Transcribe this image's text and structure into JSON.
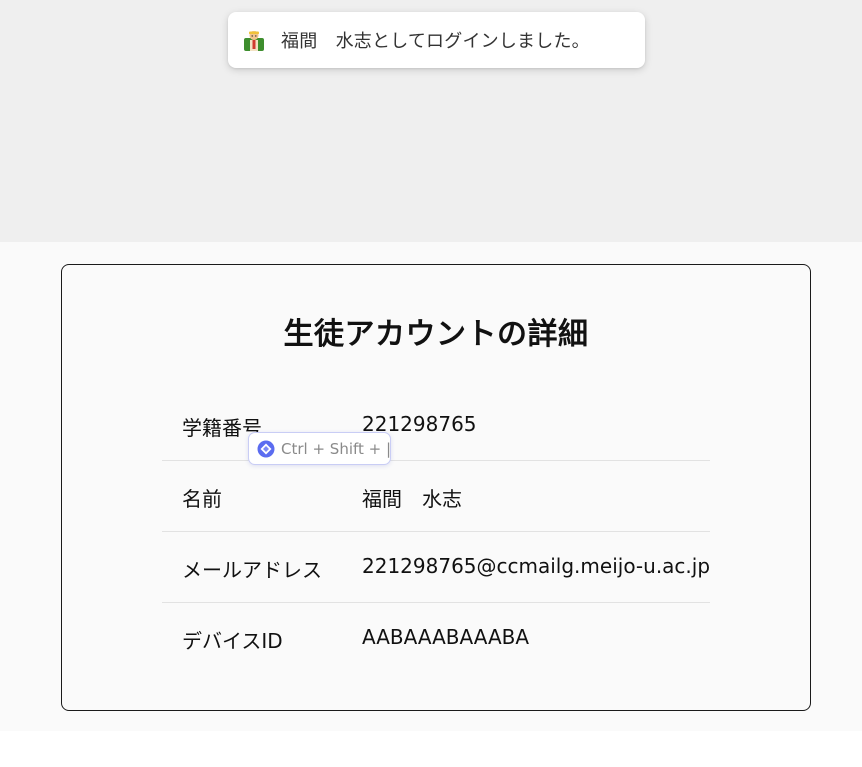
{
  "toast": {
    "icon": "student-avatar-icon",
    "message": "福間　水志としてログインしました。"
  },
  "card": {
    "title": "生徒アカウントの詳細",
    "rows": [
      {
        "label": "学籍番号",
        "value": "221298765"
      },
      {
        "label": "名前",
        "value": "福間　水志"
      },
      {
        "label": "メールアドレス",
        "value": "221298765@ccmailg.meijo-u.ac.jp"
      },
      {
        "label": "デバイスID",
        "value": "AABAAABAAABA"
      }
    ]
  },
  "shortcut_hint": {
    "icon": "assistant-logo-icon",
    "text": "Ctrl + Shift + |"
  },
  "colors": {
    "top_background": "#efefef",
    "content_background": "#fafafa",
    "card_border": "#1a1a1a",
    "divider": "#e2e2e2",
    "chip_border": "#c9cdf5",
    "chip_icon_accent": "#5b6cf0"
  }
}
